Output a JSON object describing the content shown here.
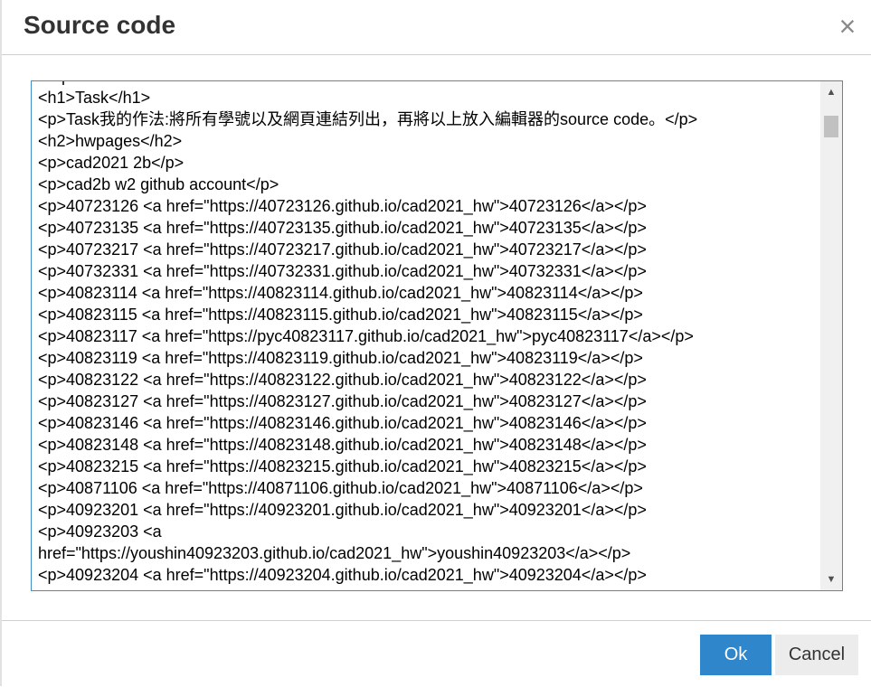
{
  "dialog": {
    "title": "Source code",
    "close_glyph": "×",
    "close_icon": "close-icon"
  },
  "editor": {
    "lines": [
      "></p>",
      "<h1>Task</h1>",
      "<p>Task我的作法:將所有學號以及網頁連結列出，再將以上放入編輯器的source code。</p>",
      "<h2>hwpages</h2>",
      "<p>cad2021 2b</p>",
      "<p>cad2b w2 github account</p>",
      "<p>40723126 <a href=\"https://40723126.github.io/cad2021_hw\">40723126</a></p>",
      "<p>40723135 <a href=\"https://40723135.github.io/cad2021_hw\">40723135</a></p>",
      "<p>40723217 <a href=\"https://40723217.github.io/cad2021_hw\">40723217</a></p>",
      "<p>40732331 <a href=\"https://40732331.github.io/cad2021_hw\">40732331</a></p>",
      "<p>40823114 <a href=\"https://40823114.github.io/cad2021_hw\">40823114</a></p>",
      "<p>40823115 <a href=\"https://40823115.github.io/cad2021_hw\">40823115</a></p>",
      "<p>40823117 <a href=\"https://pyc40823117.github.io/cad2021_hw\">pyc40823117</a></p>",
      "<p>40823119 <a href=\"https://40823119.github.io/cad2021_hw\">40823119</a></p>",
      "<p>40823122 <a href=\"https://40823122.github.io/cad2021_hw\">40823122</a></p>",
      "<p>40823127 <a href=\"https://40823127.github.io/cad2021_hw\">40823127</a></p>",
      "<p>40823146 <a href=\"https://40823146.github.io/cad2021_hw\">40823146</a></p>",
      "<p>40823148 <a href=\"https://40823148.github.io/cad2021_hw\">40823148</a></p>",
      "<p>40823215 <a href=\"https://40823215.github.io/cad2021_hw\">40823215</a></p>",
      "<p>40871106 <a href=\"https://40871106.github.io/cad2021_hw\">40871106</a></p>",
      "<p>40923201 <a href=\"https://40923201.github.io/cad2021_hw\">40923201</a></p>",
      "<p>40923203 <a",
      "href=\"https://youshin40923203.github.io/cad2021_hw\">youshin40923203</a></p>",
      "<p>40923204 <a href=\"https://40923204.github.io/cad2021_hw\">40923204</a></p>"
    ],
    "scroll_up_glyph": "▲",
    "scroll_down_glyph": "▼"
  },
  "footer": {
    "ok_label": "Ok",
    "cancel_label": "Cancel"
  },
  "colors": {
    "accent": "#2f86cb",
    "editor_border": "#3e8ecb"
  }
}
